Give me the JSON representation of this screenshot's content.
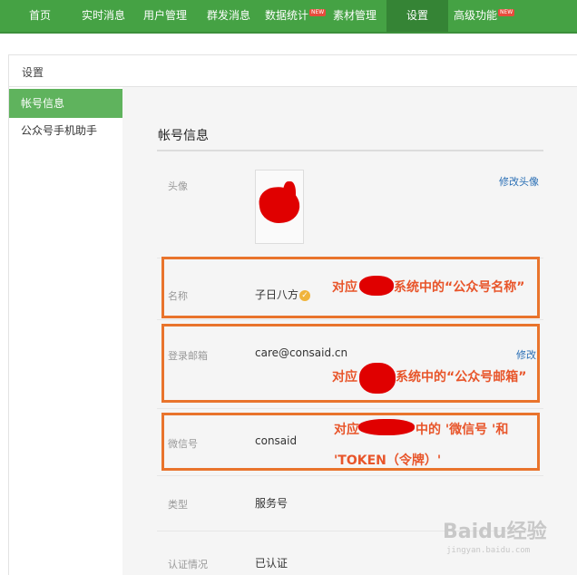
{
  "topnav": {
    "items": [
      {
        "label": "首页"
      },
      {
        "label": "实时消息"
      },
      {
        "label": "用户管理"
      },
      {
        "label": "群发消息"
      },
      {
        "label": "数据统计",
        "badge": "NEW"
      },
      {
        "label": "素材管理"
      },
      {
        "label": "设置",
        "active": true
      },
      {
        "label": "高级功能",
        "badge": "NEW"
      }
    ]
  },
  "page": {
    "title": "设置"
  },
  "sidebar": {
    "items": [
      {
        "label": "帐号信息",
        "active": true
      },
      {
        "label": "公众号手机助手"
      }
    ]
  },
  "account": {
    "section_title": "帐号信息",
    "avatar": {
      "label": "头像",
      "edit_link": "修改头像"
    },
    "name": {
      "label": "名称",
      "value": "子日八方"
    },
    "email": {
      "label": "登录邮箱",
      "value": "care@consaid.cn",
      "edit_link": "修改"
    },
    "wechat_id": {
      "label": "微信号",
      "value": "consaid"
    },
    "type": {
      "label": "类型",
      "value": "服务号"
    },
    "verification": {
      "label": "认证情况",
      "value": "已认证"
    }
  },
  "annotations": {
    "name_note_a": "对应",
    "name_note_b": "系统中的“公众号名称”",
    "email_note_a": "对应",
    "email_note_b": "系统中的“公众号邮箱”",
    "wechat_note_a": "对应",
    "wechat_note_b": "中的 '微信号 '和",
    "wechat_note_c": "'TOKEN（令牌）'"
  },
  "watermark": {
    "text": "Baidu经验",
    "sub": "jingyan.baidu.com"
  },
  "colors": {
    "nav_green": "#45a244",
    "accent_orange": "#e9742c",
    "link_blue": "#2a6fb5"
  }
}
